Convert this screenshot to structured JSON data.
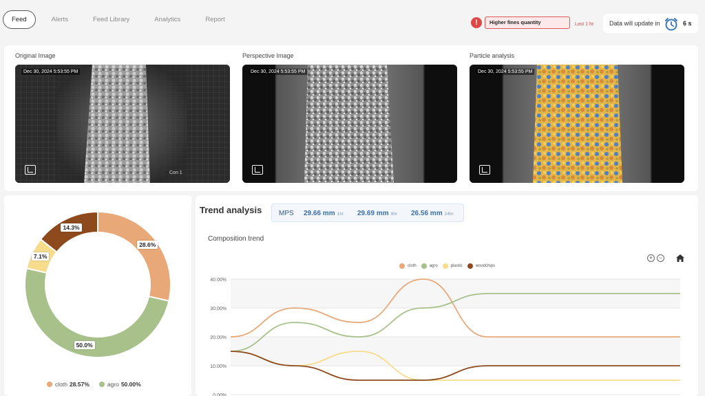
{
  "nav": {
    "tabs": [
      {
        "label": "Feed",
        "active": true
      },
      {
        "label": "Alerts"
      },
      {
        "label": "Feed Library"
      },
      {
        "label": "Analytics"
      },
      {
        "label": "Report"
      }
    ]
  },
  "alert": {
    "icon": "alert-circle-icon",
    "text": "Higher fines quantity",
    "time": "Last 1 hr",
    "color": "#e04848"
  },
  "update": {
    "text": "Data will update in",
    "countdown": "6 s",
    "icon": "alarm-clock-icon"
  },
  "images": [
    {
      "title": "Original Image",
      "timestamp": "Dec 30, 2024 5:53:55 PM",
      "camera": "Con   1"
    },
    {
      "title": "Perspective Image",
      "timestamp": "Dec 30, 2024 5:53:55 PM"
    },
    {
      "title": "Particle analysis",
      "timestamp": "Dec 30, 2024 5:53:55 PM"
    }
  ],
  "donut": {
    "slices": [
      {
        "name": "cloth",
        "value": 28.6,
        "label": "28.6%",
        "color": "#e8a878"
      },
      {
        "name": "agro",
        "value": 50.0,
        "label": "50.0%",
        "color": "#a8c08a"
      },
      {
        "name": "plastic",
        "value": 7.1,
        "label": "7.1%",
        "color": "#f6dc8c"
      },
      {
        "name": "woodchips",
        "value": 14.3,
        "label": "14.3%",
        "color": "#8e4a1c"
      }
    ],
    "legend": [
      {
        "name": "cloth",
        "value": "28.57%",
        "color": "#e8a878"
      },
      {
        "name": "agro",
        "value": "50.00%",
        "color": "#a8c08a"
      }
    ]
  },
  "trend": {
    "title": "Trend analysis",
    "mps": {
      "label": "MPS",
      "values": [
        {
          "value": "29.66 mm",
          "period": "1hr"
        },
        {
          "value": "29.69 mm",
          "period": "8hr"
        },
        {
          "value": "26.56 mm",
          "period": "24hr"
        }
      ]
    },
    "composition_title": "Composition trend"
  },
  "chart_data": {
    "type": "line",
    "title": "Composition trend",
    "x": [
      0,
      1,
      2,
      3,
      4,
      5,
      6,
      7
    ],
    "ylim": [
      0,
      40
    ],
    "yticks": [
      "0.00%",
      "10.00%",
      "20.00%",
      "30.00%",
      "40.00%"
    ],
    "grid": true,
    "legend_position": "top",
    "series": [
      {
        "name": "cloth",
        "color": "#e8a878",
        "values": [
          20,
          30,
          25,
          40,
          20,
          20,
          20,
          20
        ]
      },
      {
        "name": "agro",
        "color": "#a8c08a",
        "values": [
          15,
          25,
          20,
          30,
          35,
          35,
          35,
          35
        ]
      },
      {
        "name": "plastic",
        "color": "#f6dc8c",
        "values": [
          15,
          10,
          15,
          5,
          5,
          5,
          5,
          5
        ]
      },
      {
        "name": "woodchips",
        "color": "#8e4a1c",
        "values": [
          15,
          10,
          5,
          5,
          10,
          10,
          10,
          10
        ]
      }
    ]
  }
}
